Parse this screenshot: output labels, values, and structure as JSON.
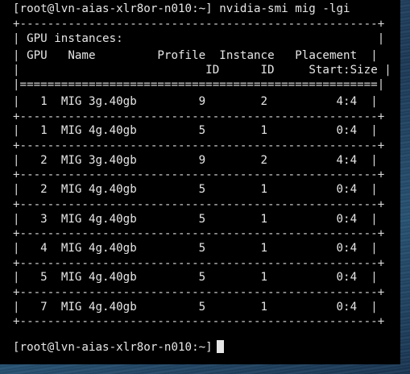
{
  "terminal": {
    "command_prompt": "[root@lvn-aias-xlr8or-n010:~]",
    "command": "nvidia-smi mig -lgi",
    "final_prompt": "[root@lvn-aias-xlr8or-n010:~]"
  },
  "table": {
    "section_title": "GPU instances:",
    "headers": {
      "gpu": "GPU",
      "name": "Name",
      "profile": "Profile",
      "profile_id": "ID",
      "instance": "Instance",
      "instance_id": "ID",
      "placement": "Placement",
      "placement_sub": "Start:Size"
    },
    "rows": [
      {
        "gpu": "1",
        "name": "MIG 3g.40gb",
        "profile_id": "9",
        "instance_id": "2",
        "placement": "4:4"
      },
      {
        "gpu": "1",
        "name": "MIG 4g.40gb",
        "profile_id": "5",
        "instance_id": "1",
        "placement": "0:4"
      },
      {
        "gpu": "2",
        "name": "MIG 3g.40gb",
        "profile_id": "9",
        "instance_id": "2",
        "placement": "4:4"
      },
      {
        "gpu": "2",
        "name": "MIG 4g.40gb",
        "profile_id": "5",
        "instance_id": "1",
        "placement": "0:4"
      },
      {
        "gpu": "3",
        "name": "MIG 4g.40gb",
        "profile_id": "5",
        "instance_id": "1",
        "placement": "0:4"
      },
      {
        "gpu": "4",
        "name": "MIG 4g.40gb",
        "profile_id": "5",
        "instance_id": "1",
        "placement": "0:4"
      },
      {
        "gpu": "5",
        "name": "MIG 4g.40gb",
        "profile_id": "5",
        "instance_id": "1",
        "placement": "0:4"
      },
      {
        "gpu": "7",
        "name": "MIG 4g.40gb",
        "profile_id": "5",
        "instance_id": "1",
        "placement": "0:4"
      }
    ]
  }
}
